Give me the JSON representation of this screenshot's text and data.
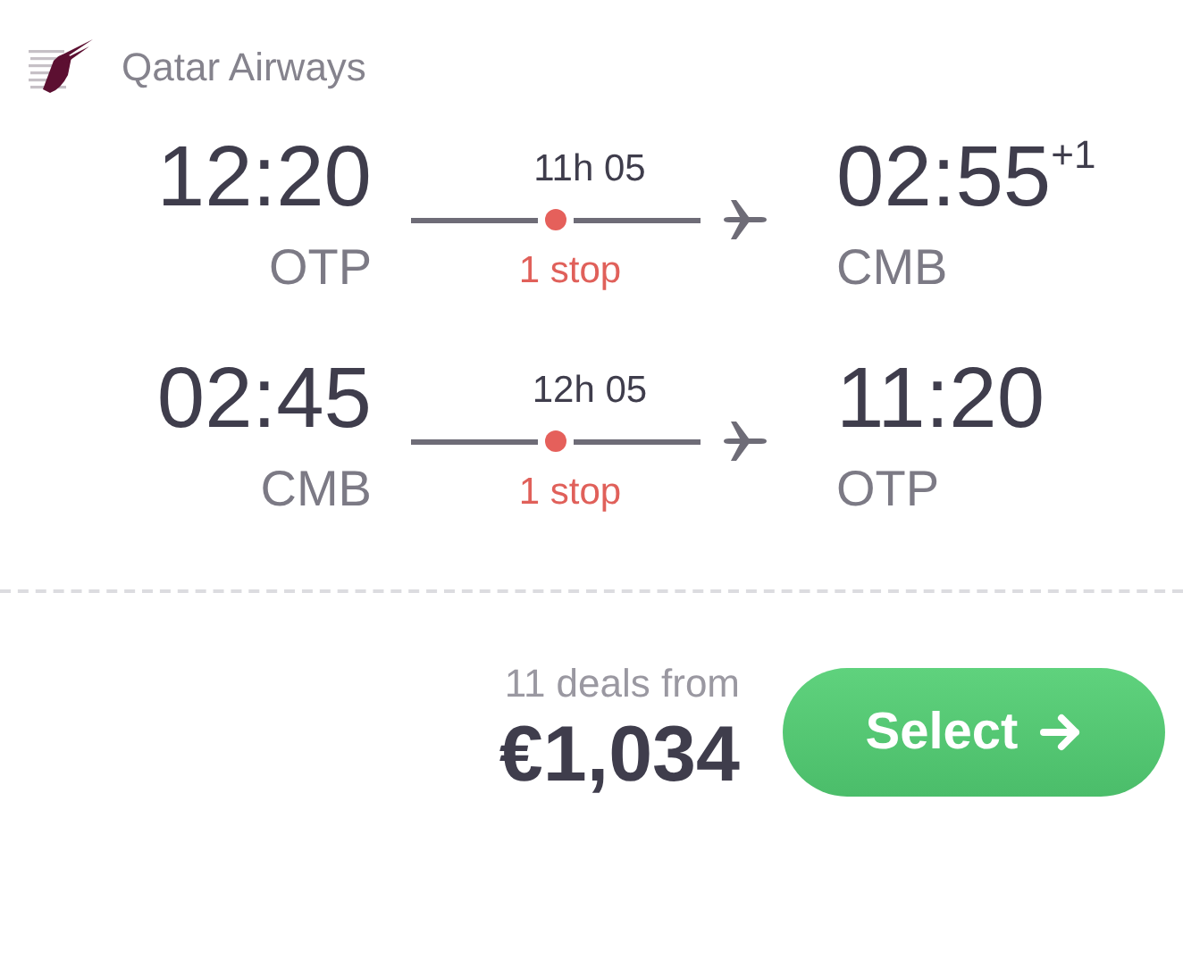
{
  "airline": {
    "name": "Qatar Airways"
  },
  "legs": [
    {
      "departure_time": "12:20",
      "departure_airport": "OTP",
      "duration": "11h 05",
      "stops": "1 stop",
      "arrival_time": "02:55",
      "day_offset": "+1",
      "arrival_airport": "CMB"
    },
    {
      "departure_time": "02:45",
      "departure_airport": "CMB",
      "duration": "12h 05",
      "stops": "1 stop",
      "arrival_time": "11:20",
      "arrival_airport": "OTP"
    }
  ],
  "footer": {
    "deals": "11 deals from",
    "price": "€1,034",
    "button": "Select"
  }
}
